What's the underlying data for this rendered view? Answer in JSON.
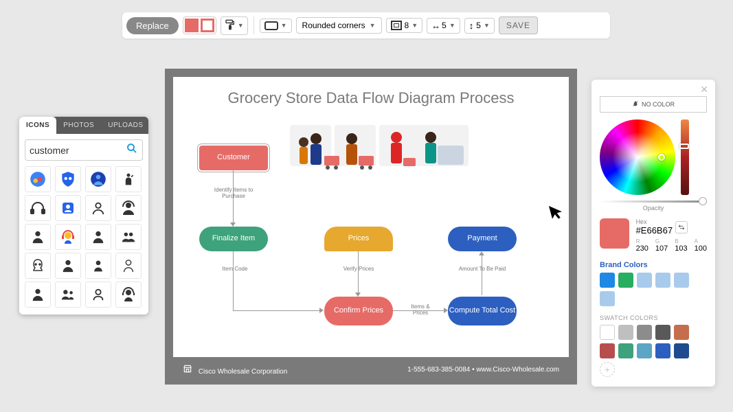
{
  "toolbar": {
    "replace_label": "Replace",
    "fill_color": "#E66B67",
    "corner_style": "Rounded corners",
    "inset_value": "8",
    "width_value": "5",
    "height_value": "5",
    "save_label": "SAVE"
  },
  "icons_panel": {
    "tabs": [
      "ICONS",
      "PHOTOS",
      "UPLOADS"
    ],
    "active_tab": "ICONS",
    "search_value": "customer",
    "icon_names": [
      "people-globe-icon",
      "family-shield-icon",
      "globe-person-icon",
      "waving-person-icon",
      "headset-icon",
      "service-rep-badge-icon",
      "person-outline-icon",
      "support-agent-icon",
      "person-silhouette-icon",
      "headset-operator-icon",
      "person-filled-icon",
      "person-group-icon",
      "female-face-icon",
      "person-dark-icon",
      "person-small-icon",
      "person-thin-icon",
      "person-alt-icon",
      "people-pair-icon",
      "person-rounded-icon",
      "headset-agent-icon"
    ]
  },
  "diagram": {
    "title": "Grocery Store Data Flow Diagram Process",
    "nodes": {
      "customer": "Customer",
      "finalize": "Finalize Item",
      "prices": "Prices",
      "confirm": "Confirm Prices",
      "compute": "Compute Total Cost",
      "payment": "Payment"
    },
    "edges": {
      "identify": "Identify Items to Purchase",
      "item_code": "Item Code",
      "verify": "Verify Prices",
      "items_prices": "Items & Prices",
      "amount": "Amount To Be Paid"
    },
    "footer_company": "Cisco Wholesale Corporation",
    "footer_contact": "1-555-683-385-0084 • www.Cisco-Wholesale.com"
  },
  "color_picker": {
    "no_color_label": "NO COLOR",
    "opacity_label": "Opacity",
    "hex_label": "Hex",
    "hex_value": "#E66B67",
    "channels": {
      "r": {
        "label": "R",
        "value": "230"
      },
      "g": {
        "label": "G",
        "value": "107"
      },
      "b": {
        "label": "B",
        "value": "103"
      },
      "a": {
        "label": "A",
        "value": "100"
      }
    },
    "brand_header": "Brand Colors",
    "brand_colors": [
      "#1E88E5",
      "#27AE60",
      "#8FBFE8",
      "#8FBFE8",
      "#8FBFE8",
      "#8FBFE8"
    ],
    "swatch_header": "SWATCH COLORS",
    "swatch_colors": [
      "#FFFFFF",
      "#BFBFBF",
      "#8C8C8C",
      "#595959",
      "#C46E4E",
      "#B84D4D",
      "#3EA27C",
      "#5AA6C4",
      "#2C5FBF",
      "#1E4B8F"
    ]
  }
}
